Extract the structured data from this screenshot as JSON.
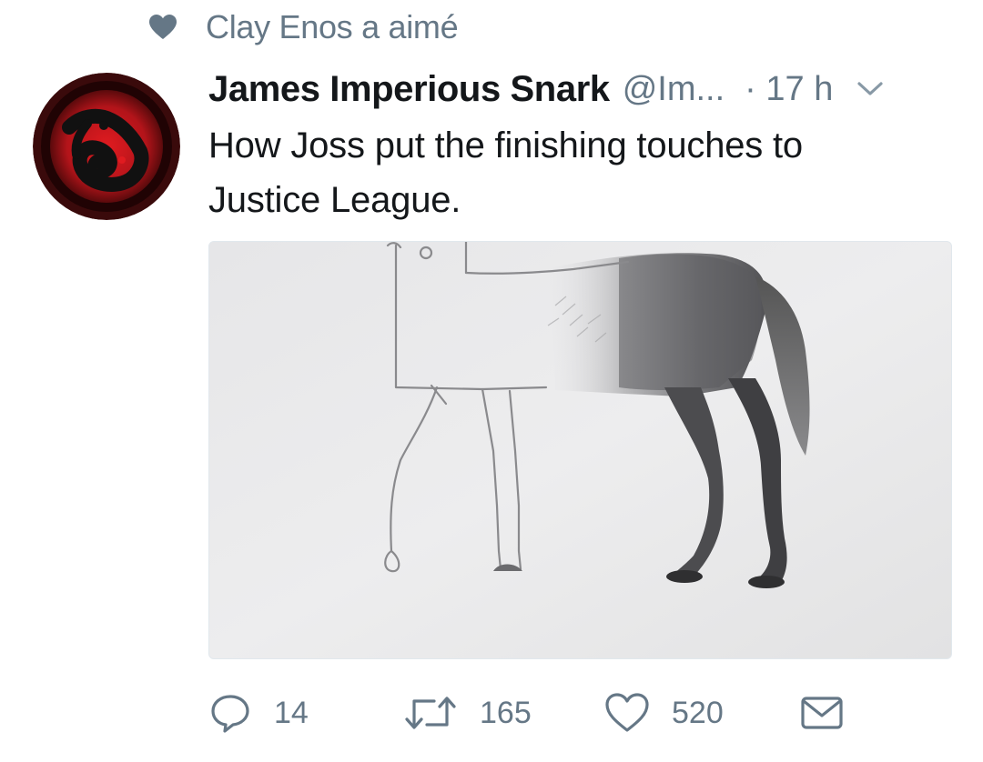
{
  "social_context": {
    "icon": "heart-icon",
    "text": "Clay Enos a aimé"
  },
  "tweet": {
    "author_name": "James Imperious Snark",
    "author_handle": "@Im...",
    "timestamp": "· 17 h",
    "text_lines": [
      "How Joss put the finishing touches to",
      "Justice League."
    ],
    "media": {
      "icon": "horse-drawing-image"
    }
  },
  "actions": {
    "replies": "14",
    "retweets": "165",
    "likes": "520",
    "icons": [
      "reply-icon",
      "retweet-icon",
      "like-icon",
      "direct-message-icon"
    ]
  },
  "colors": {
    "text_primary": "#14171a",
    "text_secondary": "#657786",
    "avatar_red": "#c8171d"
  }
}
